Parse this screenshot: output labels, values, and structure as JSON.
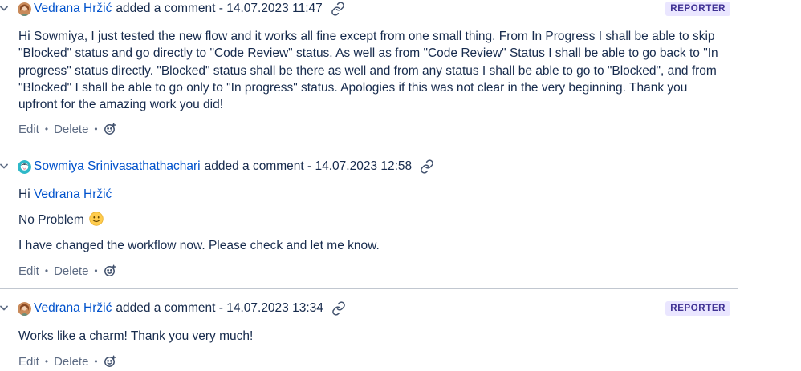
{
  "comments": [
    {
      "author": "Vedrana Hržić",
      "action": "added a comment -",
      "timestamp": "14.07.2023 11:47",
      "badge": "REPORTER",
      "text": "Hi Sowmiya, I just tested the new flow and it works all fine except from one small thing. From In Progress I shall be able to skip \"Blocked\" status and go directly to \"Code Review\" status. As well as from \"Code Review\" Status I shall be able to go back to \"In progress\" status directly. \"Blocked\" status shall be there as well and from any status I shall be able to go to \"Blocked\", and from \"Blocked\" I shall be able to go only to \"In progress\" status. Apologies if this was not clear in the very beginning. Thank you upfront for the amazing work you did!",
      "edit": "Edit",
      "delete": "Delete"
    },
    {
      "author": "Sowmiya Srinivasathathachari",
      "action": "added a comment -",
      "timestamp": "14.07.2023 12:58",
      "greeting": "Hi",
      "mention": "Vedrana Hržić",
      "line2": "No Problem",
      "line3": "I have changed the workflow now. Please check and let me know.",
      "edit": "Edit",
      "delete": "Delete"
    },
    {
      "author": "Vedrana Hržić",
      "action": "added a comment -",
      "timestamp": "14.07.2023 13:34",
      "badge": "REPORTER",
      "text": "Works like a charm! Thank you very much!",
      "edit": "Edit",
      "delete": "Delete"
    }
  ],
  "colors": {
    "link": "#0052cc",
    "text": "#172b4d",
    "muted": "#5e6c84",
    "badge_bg": "#eae6ff",
    "badge_text": "#403294",
    "divider": "#c1c7d0"
  },
  "icons": [
    "chevron-down-icon",
    "avatar",
    "link-icon",
    "add-reaction-icon",
    "smiley-emoji"
  ]
}
